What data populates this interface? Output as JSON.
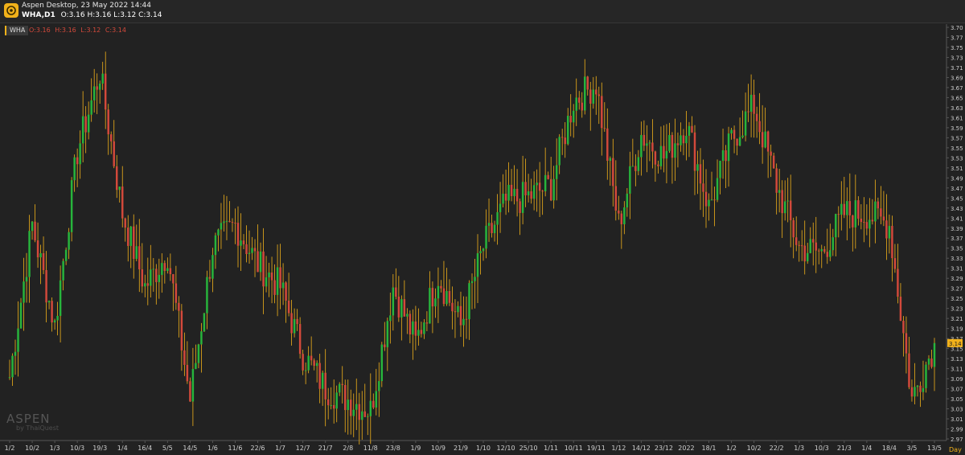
{
  "header": {
    "title": "Aspen Desktop, 23 May 2022 14:44",
    "symbol": "WHA,D1",
    "ohlc": "O:3.16 H:3.16 L:3.12 C:3.14"
  },
  "chart_header": {
    "symbol": "WHA",
    "open": "O:3.16",
    "high": "H:3.16",
    "low": "L:3.12",
    "close": "C:3.14"
  },
  "watermark": {
    "brand": "ASPEN",
    "sub": "by ThaiQuest"
  },
  "period_label": "Day",
  "colors": {
    "up": "#27b53c",
    "down": "#d3493b",
    "wick": "#f1b11a",
    "bg": "#222222",
    "grid": "#333333",
    "price_tag": "#f1b11a"
  },
  "chart_data": {
    "type": "candlestick",
    "ylim": [
      2.97,
      3.7
    ],
    "y_ticks": [
      "3.70",
      "3.77",
      "3.75",
      "3.73",
      "3.71",
      "3.69",
      "3.67",
      "3.65",
      "3.63",
      "3.61",
      "3.59",
      "3.57",
      "3.55",
      "3.53",
      "3.51",
      "3.49",
      "3.47",
      "3.45",
      "3.43",
      "3.41",
      "3.39",
      "3.37",
      "3.35",
      "3.33",
      "3.31",
      "3.29",
      "3.27",
      "3.25",
      "3.23",
      "3.21",
      "3.19",
      "3.17",
      "3.15",
      "3.13",
      "3.11",
      "3.09",
      "3.07",
      "3.05",
      "3.03",
      "3.01",
      "2.99",
      "2.97"
    ],
    "x_ticks": [
      "1/2",
      "10/2",
      "1/3",
      "10/3",
      "19/3",
      "1/4",
      "16/4",
      "5/5",
      "14/5",
      "1/6",
      "11/6",
      "22/6",
      "1/7",
      "12/7",
      "21/7",
      "2/8",
      "11/8",
      "23/8",
      "1/9",
      "10/9",
      "21/9",
      "1/10",
      "12/10",
      "25/10",
      "1/11",
      "10/11",
      "19/11",
      "1/12",
      "14/12",
      "23/12",
      "2022",
      "18/1",
      "1/2",
      "10/2",
      "22/2",
      "1/3",
      "10/3",
      "21/3",
      "1/4",
      "18/4",
      "3/5",
      "13/5"
    ],
    "last_price": "3.14",
    "anchors": [
      {
        "d": "1/2",
        "c": 3.08
      },
      {
        "d": "10/2",
        "c": 3.35
      },
      {
        "d": "1/3",
        "c": 3.17
      },
      {
        "d": "10/3",
        "c": 3.48
      },
      {
        "d": "19/3",
        "c": 3.62
      },
      {
        "d": "1/4",
        "c": 3.37
      },
      {
        "d": "16/4",
        "c": 3.24
      },
      {
        "d": "5/5",
        "c": 3.3
      },
      {
        "d": "14/5",
        "c": 3.04
      },
      {
        "d": "1/6",
        "c": 3.31
      },
      {
        "d": "11/6",
        "c": 3.35
      },
      {
        "d": "22/6",
        "c": 3.28
      },
      {
        "d": "1/7",
        "c": 3.24
      },
      {
        "d": "12/7",
        "c": 3.12
      },
      {
        "d": "21/7",
        "c": 3.06
      },
      {
        "d": "2/8",
        "c": 3.04
      },
      {
        "d": "11/8",
        "c": 3.02
      },
      {
        "d": "23/8",
        "c": 3.24
      },
      {
        "d": "1/9",
        "c": 3.14
      },
      {
        "d": "10/9",
        "c": 3.26
      },
      {
        "d": "21/9",
        "c": 3.17
      },
      {
        "d": "1/10",
        "c": 3.31
      },
      {
        "d": "12/10",
        "c": 3.39
      },
      {
        "d": "25/10",
        "c": 3.4
      },
      {
        "d": "1/11",
        "c": 3.42
      },
      {
        "d": "10/11",
        "c": 3.57
      },
      {
        "d": "19/11",
        "c": 3.6
      },
      {
        "d": "1/12",
        "c": 3.35
      },
      {
        "d": "14/12",
        "c": 3.51
      },
      {
        "d": "23/12",
        "c": 3.47
      },
      {
        "d": "2022",
        "c": 3.53
      },
      {
        "d": "18/1",
        "c": 3.38
      },
      {
        "d": "1/2",
        "c": 3.5
      },
      {
        "d": "10/2",
        "c": 3.56
      },
      {
        "d": "22/2",
        "c": 3.42
      },
      {
        "d": "1/3",
        "c": 3.31
      },
      {
        "d": "10/3",
        "c": 3.3
      },
      {
        "d": "21/3",
        "c": 3.37
      },
      {
        "d": "1/4",
        "c": 3.37
      },
      {
        "d": "18/4",
        "c": 3.35
      },
      {
        "d": "3/5",
        "c": 3.04
      },
      {
        "d": "13/5",
        "c": 3.14
      }
    ]
  }
}
